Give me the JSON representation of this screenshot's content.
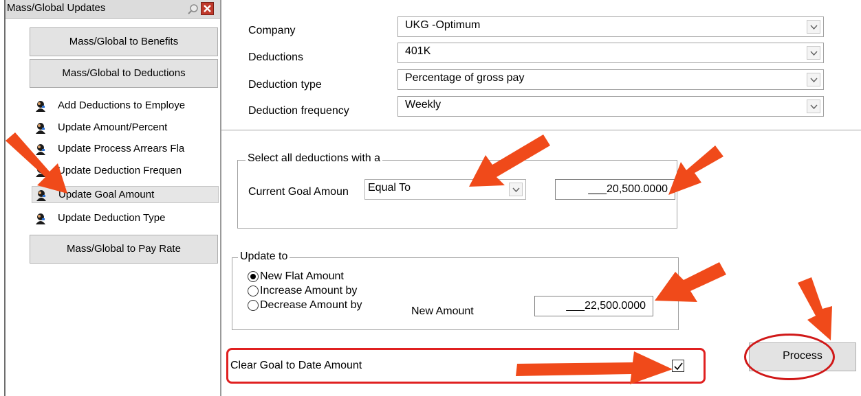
{
  "left_pane": {
    "title": "Mass/Global Updates",
    "group_benefits": "Mass/Global to Benefits",
    "group_deductions": "Mass/Global to Deductions",
    "items": [
      {
        "label": "Add Deductions to Employe"
      },
      {
        "label": "Update Amount/Percent"
      },
      {
        "label": "Update Process Arrears Fla"
      },
      {
        "label": "Update Deduction Frequen"
      },
      {
        "label": "Update Goal Amount"
      },
      {
        "label": "Update Deduction Type"
      }
    ],
    "group_pay_rate": "Mass/Global to Pay Rate"
  },
  "form": {
    "company_label": "Company",
    "company_value": "UKG -Optimum",
    "deductions_label": "Deductions",
    "deductions_value": "401K",
    "deduction_type_label": "Deduction type",
    "deduction_type_value": "Percentage of gross pay",
    "deduction_frequency_label": "Deduction frequency",
    "deduction_frequency_value": "Weekly"
  },
  "select_group": {
    "title": "Select all deductions  with a",
    "current_goal_label": "Current Goal Amoun",
    "operator_value": "Equal To",
    "amount_value": "___20,500.0000"
  },
  "update_group": {
    "title": "Update to",
    "options": [
      {
        "label": "New Flat Amount",
        "selected": true
      },
      {
        "label": "Increase Amount by",
        "selected": false
      },
      {
        "label": "Decrease Amount by",
        "selected": false
      }
    ],
    "new_amount_label": "New Amount",
    "new_amount_value": "___22,500.0000"
  },
  "clear_goal": {
    "label": "Clear Goal to Date Amount",
    "checked": true
  },
  "process_label": "Process",
  "colors": {
    "annotation_arrow": "#f04a1a",
    "highlight_outline": "#e02020",
    "button_face": "#e3e3e3"
  },
  "icons": [
    "pin-icon",
    "close-icon",
    "user-icon",
    "chevron-down-icon",
    "check-icon",
    "arrow-annotation"
  ]
}
